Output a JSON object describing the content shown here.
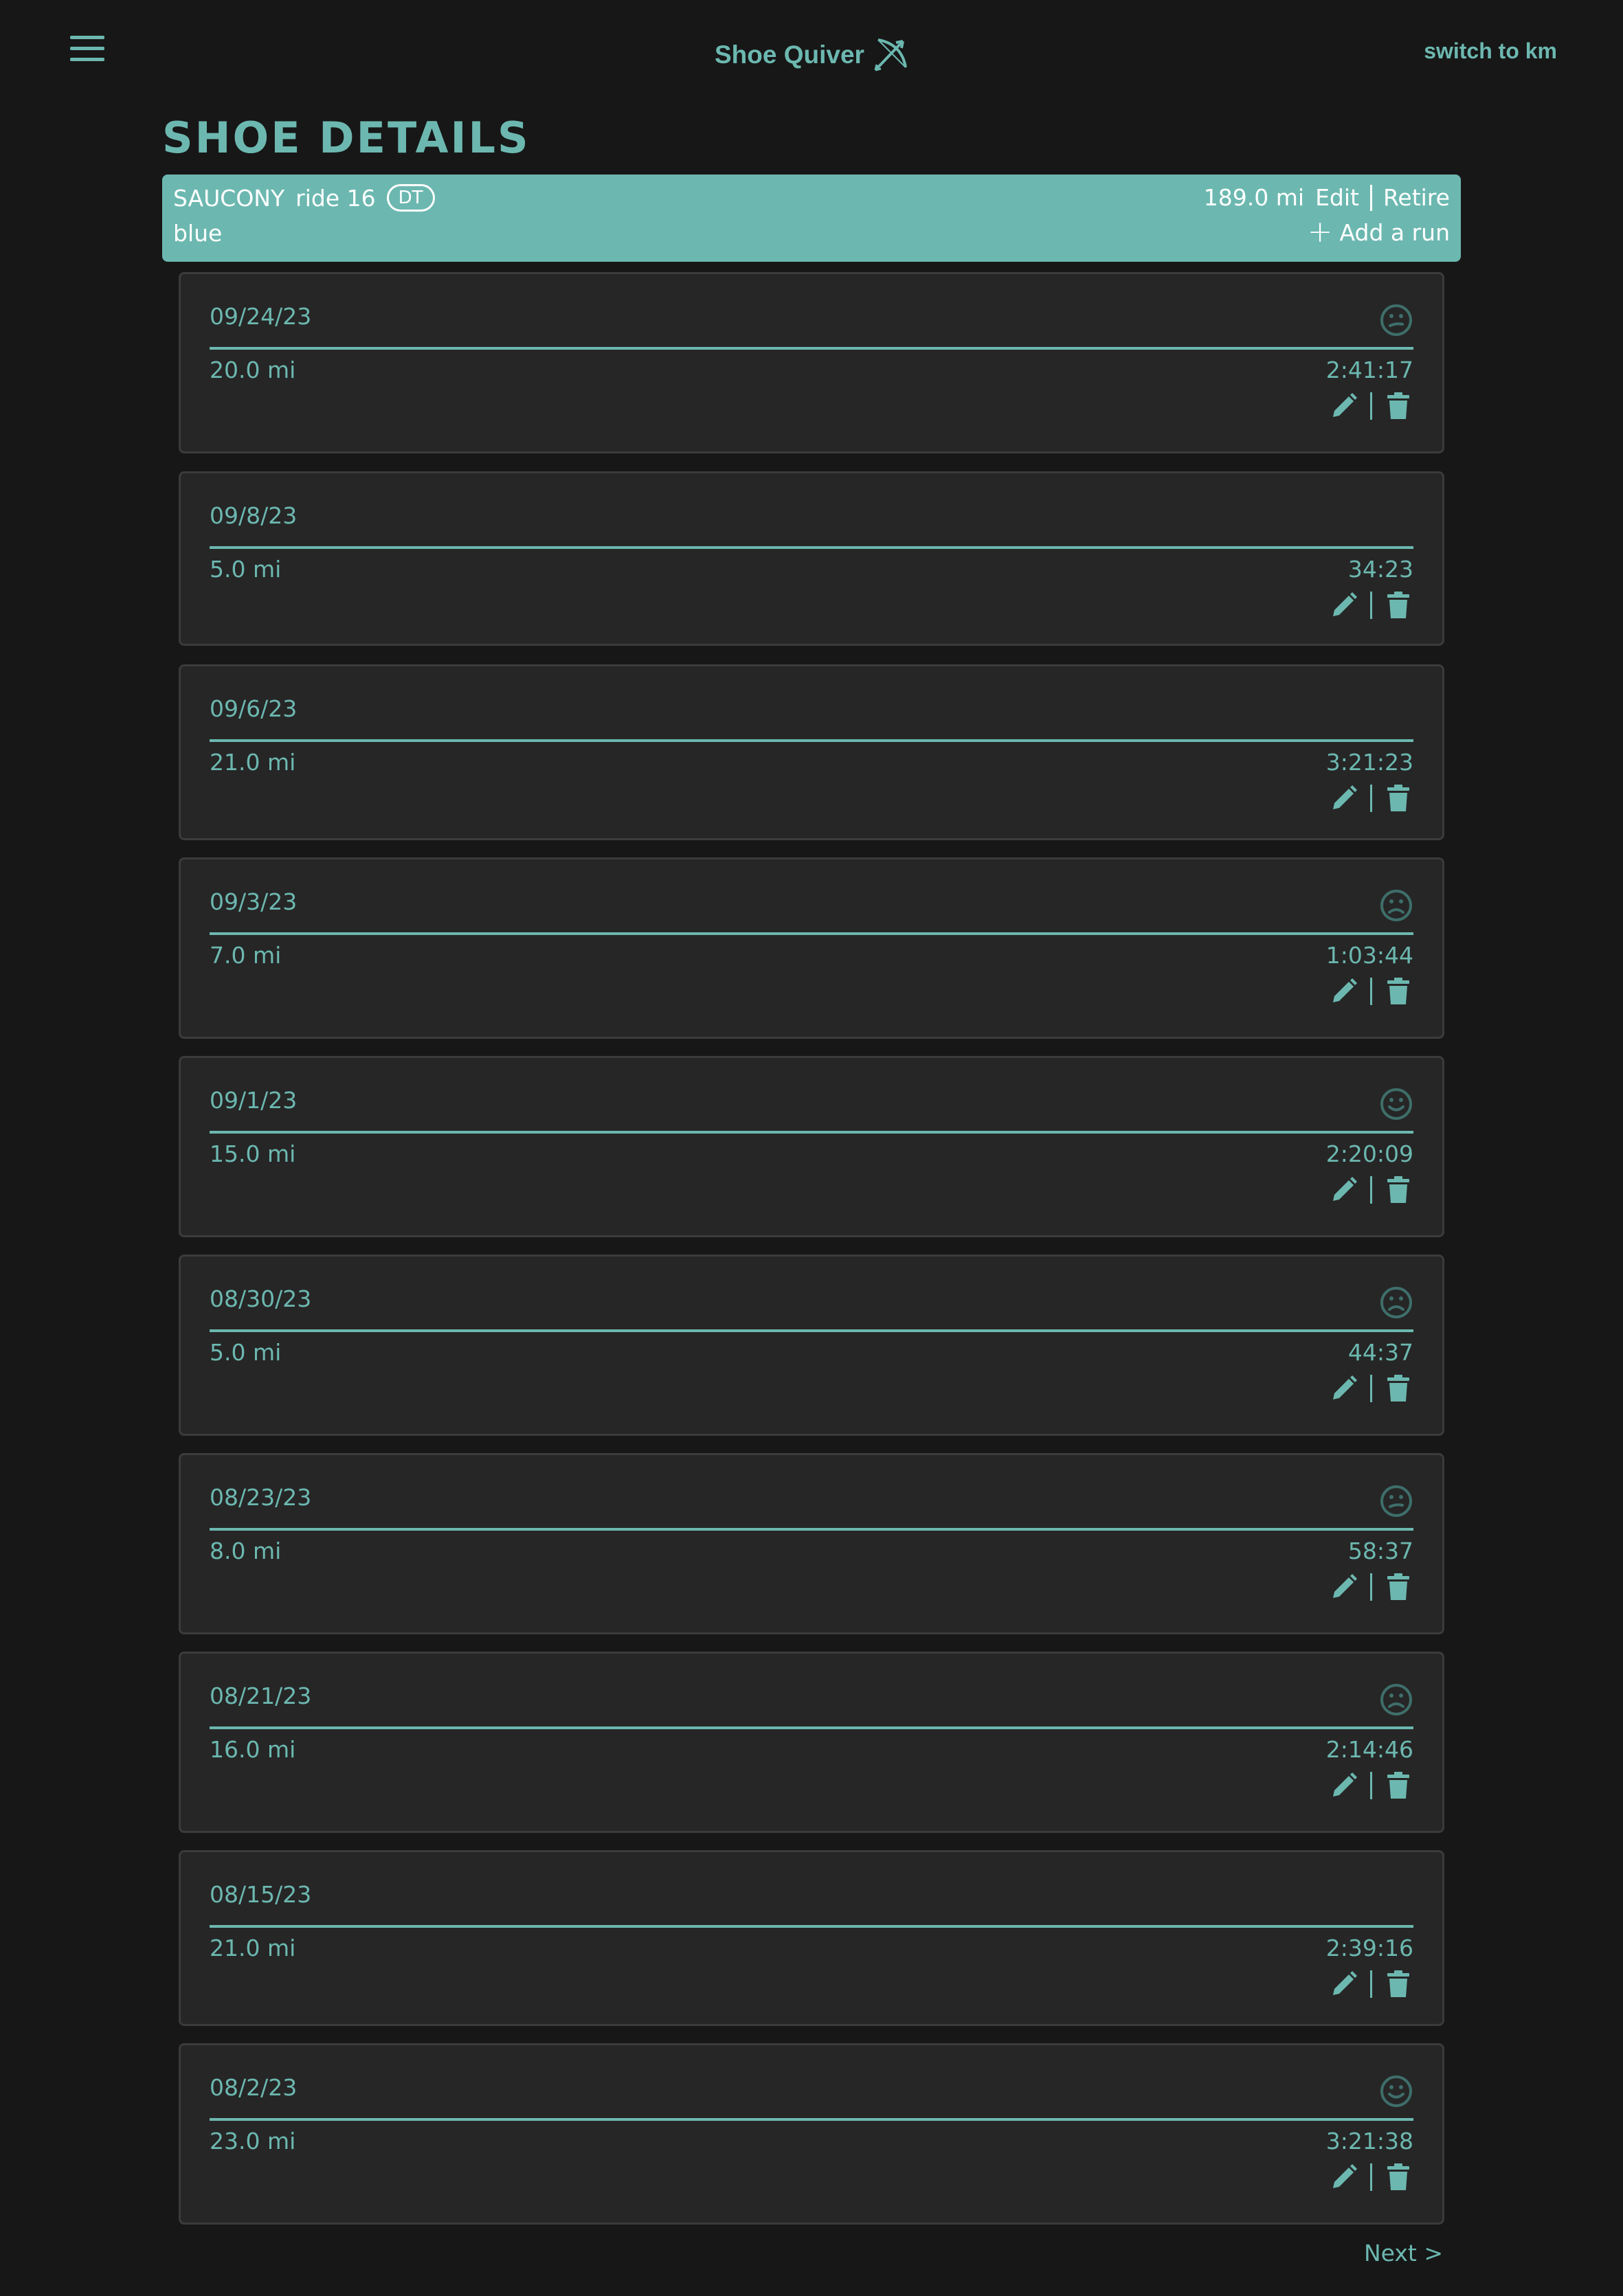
{
  "header": {
    "app_title": "Shoe Quiver",
    "unit_toggle_label": "switch to km"
  },
  "page": {
    "title": "SHOE DETAILS"
  },
  "shoe": {
    "brand": "SAUCONY",
    "model": "ride 16",
    "badge": "DT",
    "color": "blue",
    "total_distance": "189.0 mi",
    "edit_label": "Edit",
    "retire_label": "Retire",
    "add_run_label": "Add a run"
  },
  "runs": [
    {
      "date": "09/24/23",
      "distance": "20.0 mi",
      "time": "2:41:17",
      "mood": "neutral-face-icon"
    },
    {
      "date": "09/8/23",
      "distance": "5.0 mi",
      "time": "34:23",
      "mood": ""
    },
    {
      "date": "09/6/23",
      "distance": "21.0 mi",
      "time": "3:21:23",
      "mood": ""
    },
    {
      "date": "09/3/23",
      "distance": "7.0 mi",
      "time": "1:03:44",
      "mood": "sad-face-icon"
    },
    {
      "date": "09/1/23",
      "distance": "15.0 mi",
      "time": "2:20:09",
      "mood": "happy-face-icon"
    },
    {
      "date": "08/30/23",
      "distance": "5.0 mi",
      "time": "44:37",
      "mood": "sad-face-icon"
    },
    {
      "date": "08/23/23",
      "distance": "8.0 mi",
      "time": "58:37",
      "mood": "neutral-face-icon"
    },
    {
      "date": "08/21/23",
      "distance": "16.0 mi",
      "time": "2:14:46",
      "mood": "sad-face-icon"
    },
    {
      "date": "08/15/23",
      "distance": "21.0 mi",
      "time": "2:39:16",
      "mood": ""
    },
    {
      "date": "08/2/23",
      "distance": "23.0 mi",
      "time": "3:21:38",
      "mood": "happy-face-icon"
    }
  ],
  "pagination": {
    "next_label": "Next >"
  },
  "colors": {
    "accent": "#6cb8b0",
    "background": "#171717",
    "card": "#262626",
    "mood_icon": "#3e6e6a"
  }
}
